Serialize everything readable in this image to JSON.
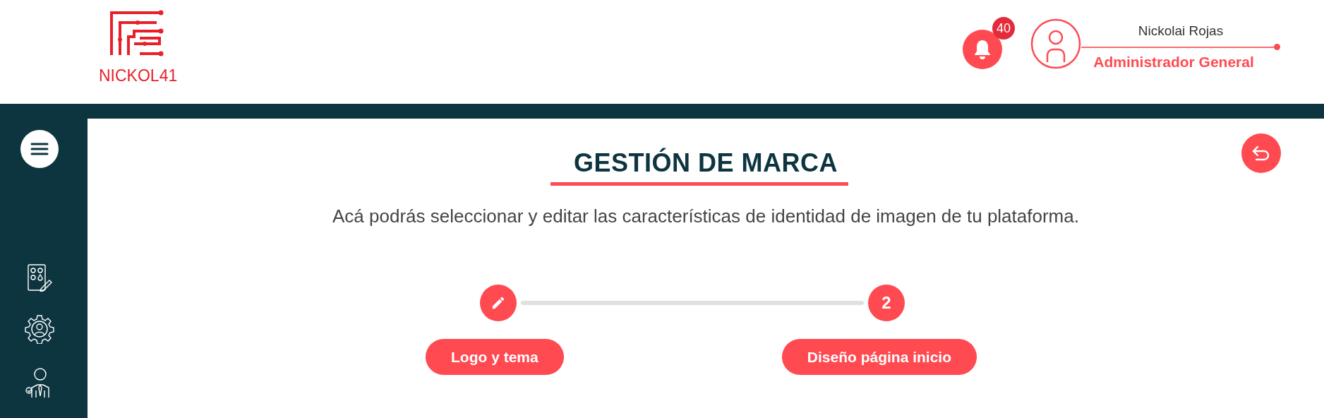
{
  "brand": {
    "name": "NICKOL41"
  },
  "notifications": {
    "count": "40"
  },
  "user": {
    "name": "Nickolai Rojas",
    "role": "Administrador General"
  },
  "page": {
    "title": "GESTIÓN DE MARCA",
    "description": "Acá podrás seleccionar y editar las características de identidad de imagen de tu plataforma."
  },
  "steps": [
    {
      "kind": "edit",
      "label": "Logo y tema"
    },
    {
      "kind": "number",
      "number": "2",
      "label": "Diseño página inicio"
    }
  ]
}
